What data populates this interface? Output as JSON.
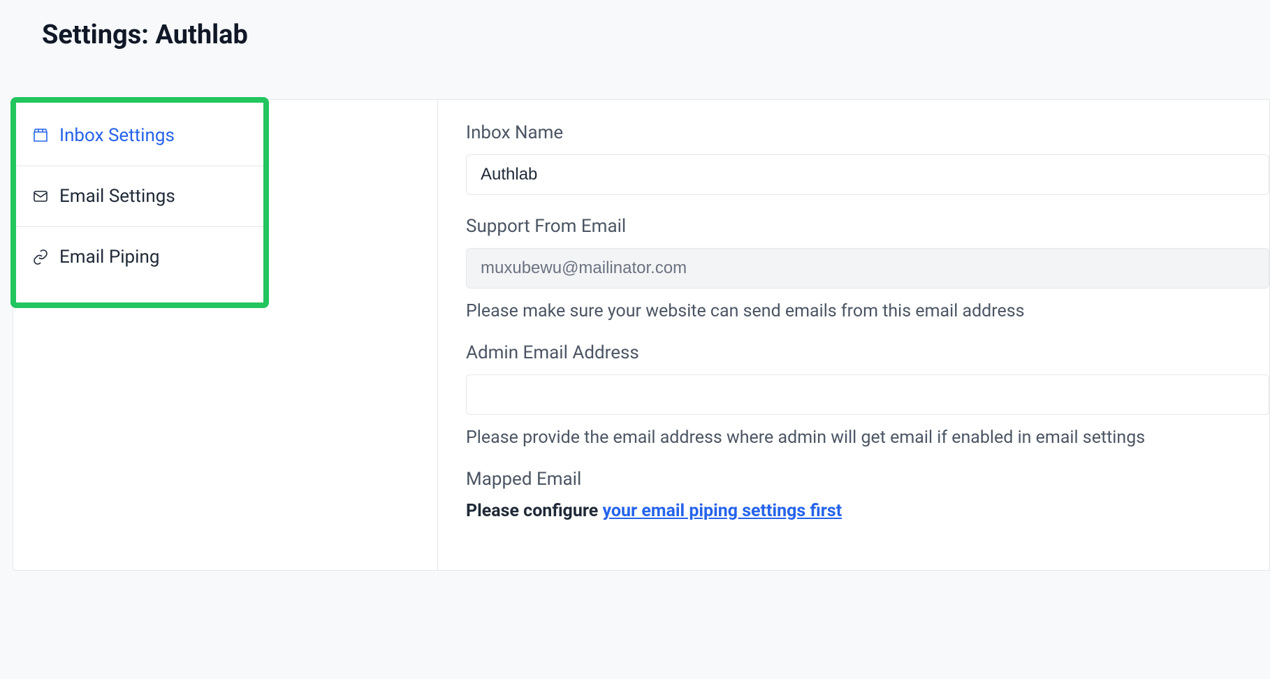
{
  "header": {
    "title": "Settings: Authlab"
  },
  "sidebar": {
    "items": [
      {
        "label": "Inbox Settings",
        "icon": "inbox"
      },
      {
        "label": "Email Settings",
        "icon": "mail"
      },
      {
        "label": "Email Piping",
        "icon": "link"
      }
    ]
  },
  "form": {
    "inbox_name": {
      "label": "Inbox Name",
      "value": "Authlab"
    },
    "support_from": {
      "label": "Support From Email",
      "value": "muxubewu@mailinator.com",
      "help": "Please make sure your website can send emails from this email address"
    },
    "admin_email": {
      "label": "Admin Email Address",
      "value": "",
      "help": "Please provide the email address where admin will get email if enabled in email settings"
    },
    "mapped_email": {
      "label": "Mapped Email",
      "notice_prefix": "Please configure ",
      "notice_link": "your email piping settings first"
    }
  }
}
